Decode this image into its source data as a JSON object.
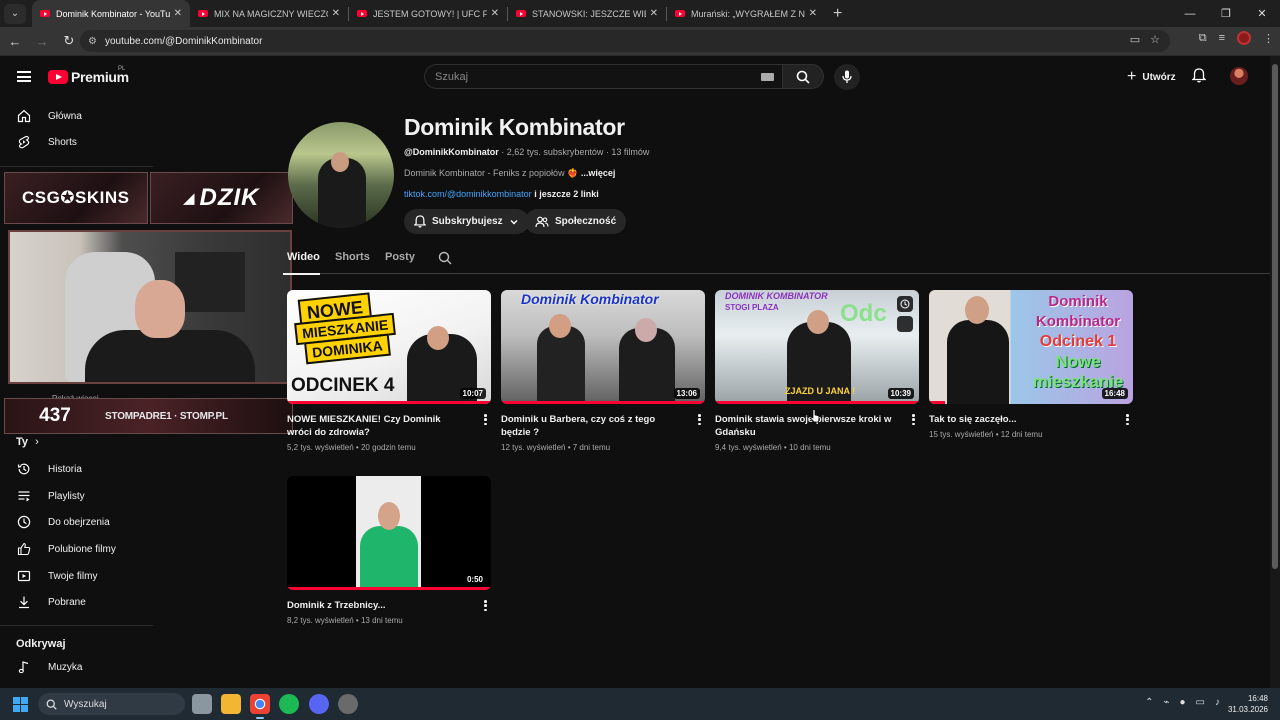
{
  "browser": {
    "tabs": [
      {
        "title": "Dominik Kombinator - YouTube",
        "active": true
      },
      {
        "title": "MIX NA MAGICZNY WIECZÓR z",
        "active": false
      },
      {
        "title": "JESTEM GOTOWY! | UFC FIGHT",
        "active": false
      },
      {
        "title": "STANOWSKI: JESZCZE WIĘCEJ K",
        "active": false
      },
      {
        "title": "Murański: „WYGRAŁEM Z NITR",
        "active": false
      }
    ],
    "url": "youtube.com/@DominikKombinator"
  },
  "masthead": {
    "logo_text": "Premium",
    "country_code": "PL",
    "search_placeholder": "Szukaj",
    "create_label": "Utwórz"
  },
  "sidebar": {
    "top_items": [
      {
        "label": "Główna",
        "icon": "home-icon"
      },
      {
        "label": "Shorts",
        "icon": "shorts-icon"
      }
    ],
    "hidden_more_label": "Pokaż więcej",
    "you_section_label": "Ty",
    "you_items": [
      {
        "label": "Historia",
        "icon": "history-icon"
      },
      {
        "label": "Playlisty",
        "icon": "playlist-icon"
      },
      {
        "label": "Do obejrzenia",
        "icon": "watch-later-icon"
      },
      {
        "label": "Polubione filmy",
        "icon": "thumbs-up-icon"
      },
      {
        "label": "Twoje filmy",
        "icon": "your-videos-icon"
      },
      {
        "label": "Pobrane",
        "icon": "download-icon"
      }
    ],
    "explore_label": "Odkrywaj",
    "explore_items": [
      {
        "label": "Muzyka",
        "icon": "music-icon"
      }
    ]
  },
  "overlay": {
    "logo_left": "CSG✪SKINS",
    "logo_right": "DZIK",
    "counter": "437",
    "socials": "STOMPADRE1 · STOMP.PL"
  },
  "channel": {
    "name": "Dominik Kombinator",
    "handle": "@DominikKombinator",
    "subscribers": "2,62 tys. subskrybentów",
    "video_count": "13 filmów",
    "description": "Dominik Kombinator - Feniks z popiołów",
    "more_label": "...więcej",
    "link": "tiktok.com/@dominikkombinator",
    "extra_links": "i jeszcze 2 linki",
    "subscribed_label": "Subskrybujesz",
    "community_label": "Społeczność"
  },
  "tabs": [
    {
      "label": "Wideo",
      "active": true
    },
    {
      "label": "Shorts",
      "active": false
    },
    {
      "label": "Posty",
      "active": false
    }
  ],
  "videos": [
    {
      "title": "NOWE MIESZKANIE! Czy Dominik wróci do zdrowia?",
      "views": "5,2 tys. wyświetleń",
      "age": "20 godzin temu",
      "duration": "10:07",
      "watched_progress": 1.0,
      "thumb_text": [
        "NOWE",
        "MIESZKANIE",
        "DOMINIKA",
        "ODCINEK 4"
      ]
    },
    {
      "title": "Dominik u Barbera, czy coś z tego będzie ?",
      "views": "12 tys. wyświetleń",
      "age": "7 dni temu",
      "duration": "13:06",
      "watched_progress": 1.0,
      "thumb_text": [
        "Dominik Kombinator"
      ]
    },
    {
      "title": "Dominik stawia swoje pierwsze kroki w Gdańsku",
      "views": "9,4 tys. wyświetleń",
      "age": "10 dni temu",
      "duration": "10:39",
      "watched_progress": 1.0,
      "thumb_text": [
        "DOMINIK KOMBINATOR",
        "STOGI PLAZA",
        "Odc",
        "ZJAZD U JANA !"
      ]
    },
    {
      "title": "Tak to się zaczęło...",
      "views": "15 tys. wyświetleń",
      "age": "12 dni temu",
      "duration": "16:48",
      "watched_progress": 0.08,
      "thumb_text": [
        "Dominik Kombinator",
        "Odcinek 1",
        "Nowe mieszkanie"
      ]
    },
    {
      "title": "Dominik z Trzebnicy...",
      "views": "8,2 tys. wyświetleń",
      "age": "13 dni temu",
      "duration": "0:50",
      "watched_progress": 1.0,
      "thumb_text": []
    }
  ],
  "taskbar": {
    "search_placeholder": "Wyszukaj",
    "time": "16:48",
    "date": "31.03.2026"
  },
  "colors": {
    "accent": "#ff0033",
    "link": "#3ea6ff",
    "background": "#0f0f0f"
  }
}
